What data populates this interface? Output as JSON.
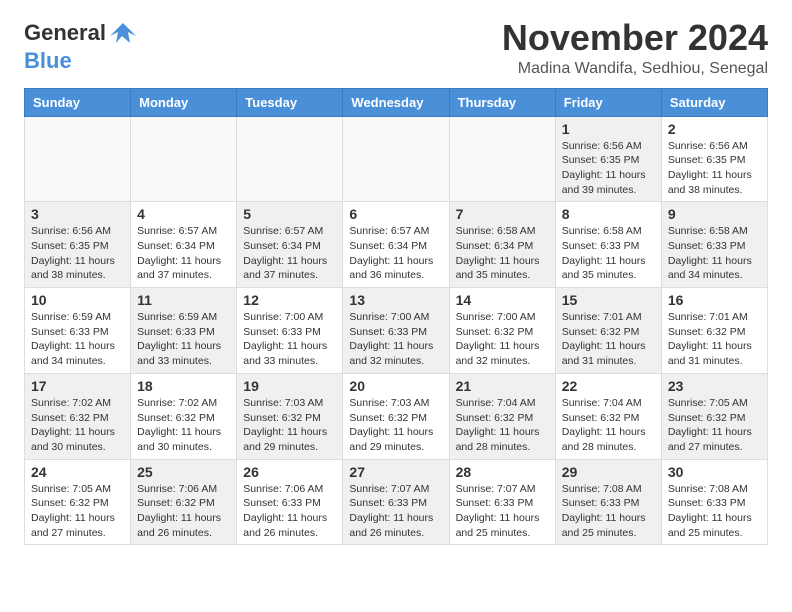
{
  "header": {
    "logo": {
      "general": "General",
      "blue": "Blue"
    },
    "month_title": "November 2024",
    "location": "Madina Wandifa, Sedhiou, Senegal"
  },
  "calendar": {
    "days_of_week": [
      "Sunday",
      "Monday",
      "Tuesday",
      "Wednesday",
      "Thursday",
      "Friday",
      "Saturday"
    ],
    "weeks": [
      [
        {
          "day": "",
          "info": "",
          "empty": true
        },
        {
          "day": "",
          "info": "",
          "empty": true
        },
        {
          "day": "",
          "info": "",
          "empty": true
        },
        {
          "day": "",
          "info": "",
          "empty": true
        },
        {
          "day": "",
          "info": "",
          "empty": true
        },
        {
          "day": "1",
          "info": "Sunrise: 6:56 AM\nSunset: 6:35 PM\nDaylight: 11 hours\nand 39 minutes.",
          "shaded": true
        },
        {
          "day": "2",
          "info": "Sunrise: 6:56 AM\nSunset: 6:35 PM\nDaylight: 11 hours\nand 38 minutes.",
          "shaded": false
        }
      ],
      [
        {
          "day": "3",
          "info": "Sunrise: 6:56 AM\nSunset: 6:35 PM\nDaylight: 11 hours\nand 38 minutes.",
          "shaded": true
        },
        {
          "day": "4",
          "info": "Sunrise: 6:57 AM\nSunset: 6:34 PM\nDaylight: 11 hours\nand 37 minutes.",
          "shaded": false
        },
        {
          "day": "5",
          "info": "Sunrise: 6:57 AM\nSunset: 6:34 PM\nDaylight: 11 hours\nand 37 minutes.",
          "shaded": true
        },
        {
          "day": "6",
          "info": "Sunrise: 6:57 AM\nSunset: 6:34 PM\nDaylight: 11 hours\nand 36 minutes.",
          "shaded": false
        },
        {
          "day": "7",
          "info": "Sunrise: 6:58 AM\nSunset: 6:34 PM\nDaylight: 11 hours\nand 35 minutes.",
          "shaded": true
        },
        {
          "day": "8",
          "info": "Sunrise: 6:58 AM\nSunset: 6:33 PM\nDaylight: 11 hours\nand 35 minutes.",
          "shaded": false
        },
        {
          "day": "9",
          "info": "Sunrise: 6:58 AM\nSunset: 6:33 PM\nDaylight: 11 hours\nand 34 minutes.",
          "shaded": true
        }
      ],
      [
        {
          "day": "10",
          "info": "Sunrise: 6:59 AM\nSunset: 6:33 PM\nDaylight: 11 hours\nand 34 minutes.",
          "shaded": false
        },
        {
          "day": "11",
          "info": "Sunrise: 6:59 AM\nSunset: 6:33 PM\nDaylight: 11 hours\nand 33 minutes.",
          "shaded": true
        },
        {
          "day": "12",
          "info": "Sunrise: 7:00 AM\nSunset: 6:33 PM\nDaylight: 11 hours\nand 33 minutes.",
          "shaded": false
        },
        {
          "day": "13",
          "info": "Sunrise: 7:00 AM\nSunset: 6:33 PM\nDaylight: 11 hours\nand 32 minutes.",
          "shaded": true
        },
        {
          "day": "14",
          "info": "Sunrise: 7:00 AM\nSunset: 6:32 PM\nDaylight: 11 hours\nand 32 minutes.",
          "shaded": false
        },
        {
          "day": "15",
          "info": "Sunrise: 7:01 AM\nSunset: 6:32 PM\nDaylight: 11 hours\nand 31 minutes.",
          "shaded": true
        },
        {
          "day": "16",
          "info": "Sunrise: 7:01 AM\nSunset: 6:32 PM\nDaylight: 11 hours\nand 31 minutes.",
          "shaded": false
        }
      ],
      [
        {
          "day": "17",
          "info": "Sunrise: 7:02 AM\nSunset: 6:32 PM\nDaylight: 11 hours\nand 30 minutes.",
          "shaded": true
        },
        {
          "day": "18",
          "info": "Sunrise: 7:02 AM\nSunset: 6:32 PM\nDaylight: 11 hours\nand 30 minutes.",
          "shaded": false
        },
        {
          "day": "19",
          "info": "Sunrise: 7:03 AM\nSunset: 6:32 PM\nDaylight: 11 hours\nand 29 minutes.",
          "shaded": true
        },
        {
          "day": "20",
          "info": "Sunrise: 7:03 AM\nSunset: 6:32 PM\nDaylight: 11 hours\nand 29 minutes.",
          "shaded": false
        },
        {
          "day": "21",
          "info": "Sunrise: 7:04 AM\nSunset: 6:32 PM\nDaylight: 11 hours\nand 28 minutes.",
          "shaded": true
        },
        {
          "day": "22",
          "info": "Sunrise: 7:04 AM\nSunset: 6:32 PM\nDaylight: 11 hours\nand 28 minutes.",
          "shaded": false
        },
        {
          "day": "23",
          "info": "Sunrise: 7:05 AM\nSunset: 6:32 PM\nDaylight: 11 hours\nand 27 minutes.",
          "shaded": true
        }
      ],
      [
        {
          "day": "24",
          "info": "Sunrise: 7:05 AM\nSunset: 6:32 PM\nDaylight: 11 hours\nand 27 minutes.",
          "shaded": false
        },
        {
          "day": "25",
          "info": "Sunrise: 7:06 AM\nSunset: 6:32 PM\nDaylight: 11 hours\nand 26 minutes.",
          "shaded": true
        },
        {
          "day": "26",
          "info": "Sunrise: 7:06 AM\nSunset: 6:33 PM\nDaylight: 11 hours\nand 26 minutes.",
          "shaded": false
        },
        {
          "day": "27",
          "info": "Sunrise: 7:07 AM\nSunset: 6:33 PM\nDaylight: 11 hours\nand 26 minutes.",
          "shaded": true
        },
        {
          "day": "28",
          "info": "Sunrise: 7:07 AM\nSunset: 6:33 PM\nDaylight: 11 hours\nand 25 minutes.",
          "shaded": false
        },
        {
          "day": "29",
          "info": "Sunrise: 7:08 AM\nSunset: 6:33 PM\nDaylight: 11 hours\nand 25 minutes.",
          "shaded": true
        },
        {
          "day": "30",
          "info": "Sunrise: 7:08 AM\nSunset: 6:33 PM\nDaylight: 11 hours\nand 25 minutes.",
          "shaded": false
        }
      ]
    ]
  }
}
